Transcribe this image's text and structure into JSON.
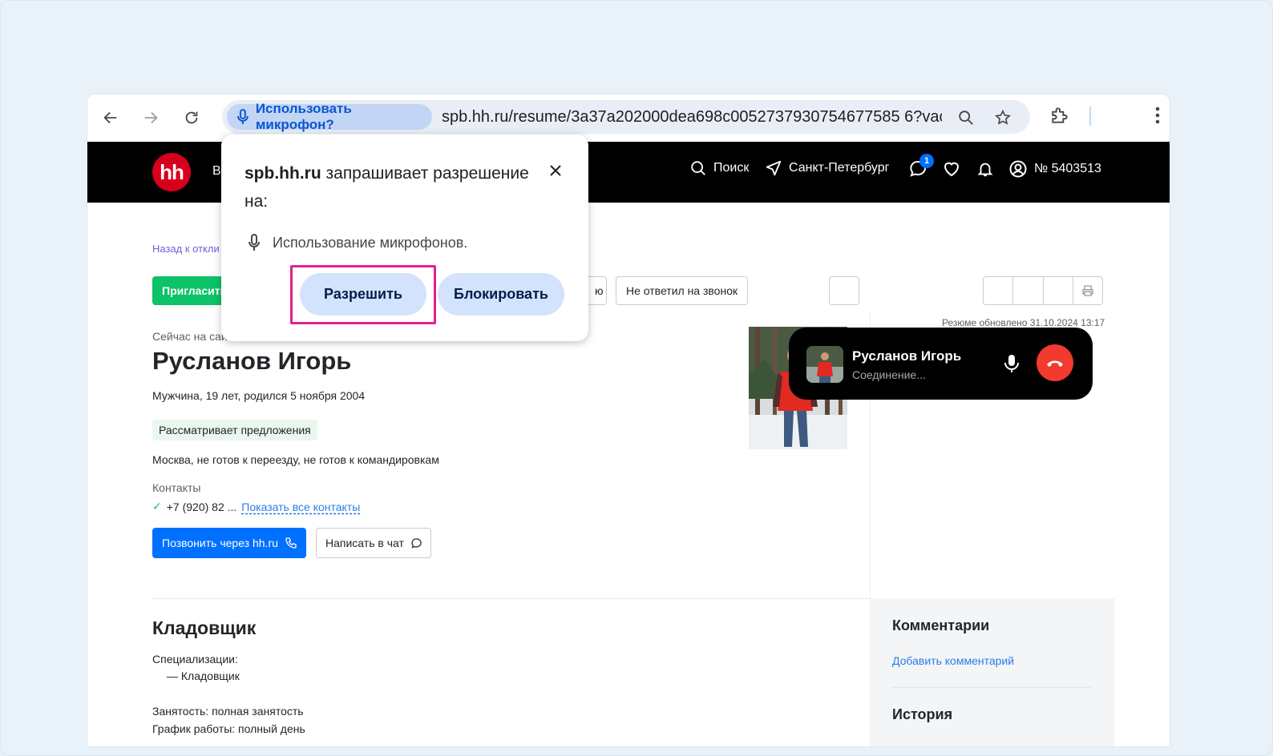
{
  "browser": {
    "permission_chip": "Использовать микрофон?",
    "url": "spb.hh.ru/resume/3a37a202000dea698c0052737930754677585 6?vac..."
  },
  "header": {
    "logo": "hh",
    "nav_partial": "В",
    "search": "Поиск",
    "city": "Санкт-Петербург",
    "notification_count": "1",
    "account": "№ 5403513"
  },
  "page": {
    "back_link": "Назад к откли",
    "invite_button": "Пригласить",
    "partial_button": "ю",
    "no_answer_button": "Не ответил на звонок",
    "updated": "Резюме обновлено 31.10.2024 13:17",
    "online_status": "Сейчас на сай",
    "name": "Русланов Игорь",
    "bio": "Мужчина, 19 лет, родился 5 ноября 2004",
    "job_search_tag": "Рассматривает предложения",
    "location": "Москва, не готов к переезду, не готов к командировкам",
    "contacts_label": "Контакты",
    "phone": "+7 (920) 82 ...",
    "show_contacts": "Показать все контакты",
    "call_button": "Позвонить через hh.ru",
    "chat_button": "Написать в чат",
    "position_title": "Кладовщик",
    "spec_label": "Специализации:",
    "spec_item": "— Кладовщик",
    "employment": "Занятость: полная занятость",
    "schedule": "График работы: полный день"
  },
  "sidebar": {
    "comments_title": "Комментарии",
    "add_comment": "Добавить комментарий",
    "history_title": "История"
  },
  "call": {
    "name": "Русланов Игорь",
    "status": "Соединение..."
  },
  "popup": {
    "site": "spb.hh.ru",
    "title_rest": " запрашивает разрешение на:",
    "permission": "Использование микрофонов.",
    "allow": "Разрешить",
    "block": "Блокировать"
  },
  "colors": {
    "hh_red": "#d6001c",
    "invite_green": "#0dc267",
    "call_blue": "#0070ff",
    "highlight": "#e0218a",
    "hangup_red": "#f33a2e"
  }
}
